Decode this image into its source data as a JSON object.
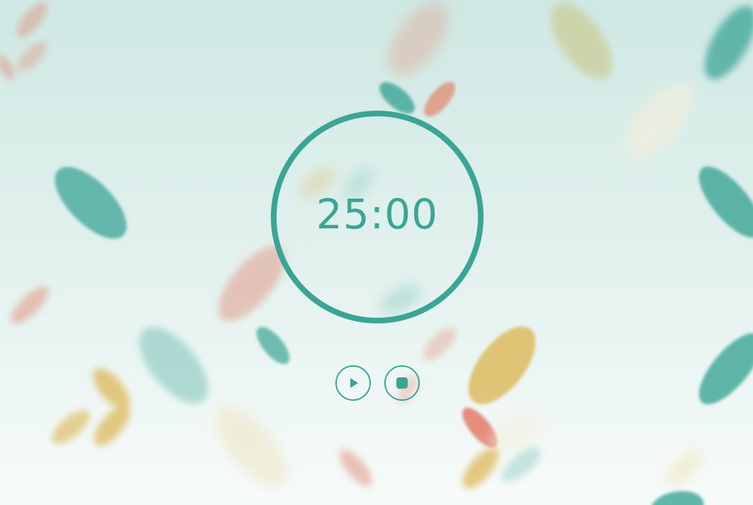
{
  "timer": {
    "display": "25:00"
  },
  "controls": [
    {
      "name": "play",
      "icon": "play-icon"
    },
    {
      "name": "stop",
      "icon": "stop-icon"
    }
  ],
  "colors": {
    "accent": "#3aa595",
    "leaf_teal": "#3aa595",
    "leaf_coral": "#e08a73",
    "leaf_gold": "#dcb44e",
    "leaf_sage": "#c9c98e",
    "leaf_cream": "#efe8d0"
  }
}
